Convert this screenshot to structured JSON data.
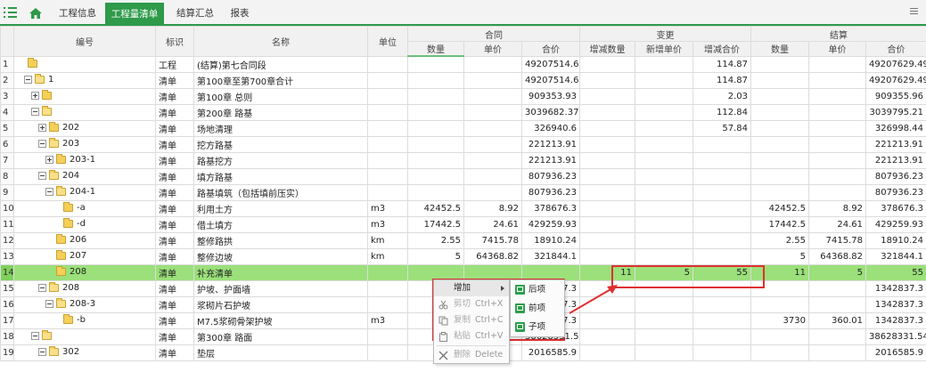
{
  "toolbar": {
    "tabs": [
      {
        "label": "工程信息"
      },
      {
        "label": "工程量清单"
      },
      {
        "label": "结算汇总"
      },
      {
        "label": "报表"
      }
    ]
  },
  "columns": {
    "code": "编号",
    "mark": "标识",
    "name": "名称",
    "unit": "单位",
    "contract": "合同",
    "change": "变更",
    "settle": "结算",
    "qty": "数量",
    "price": "单价",
    "total": "合价",
    "chg_qty": "增减数量",
    "new_price": "新增单价",
    "chg_total": "增减合价"
  },
  "rows": [
    {
      "n": "1",
      "code": "",
      "mark": "工程",
      "name": "(结算)第七合同段",
      "unit": "",
      "c_qty": "",
      "c_price": "",
      "c_total": "49207514.62",
      "v_qty": "",
      "v_price": "",
      "v_total": "114.87",
      "s_qty": "",
      "s_price": "",
      "s_total": "49207629.49"
    },
    {
      "n": "2",
      "code": "1",
      "mark": "清单",
      "name": "第100章至第700章合计",
      "unit": "",
      "c_qty": "",
      "c_price": "",
      "c_total": "49207514.62",
      "v_qty": "",
      "v_price": "",
      "v_total": "114.87",
      "s_qty": "",
      "s_price": "",
      "s_total": "49207629.49"
    },
    {
      "n": "3",
      "code": "",
      "mark": "清单",
      "name": "第100章 总则",
      "unit": "",
      "c_qty": "",
      "c_price": "",
      "c_total": "909353.93",
      "v_qty": "",
      "v_price": "",
      "v_total": "2.03",
      "s_qty": "",
      "s_price": "",
      "s_total": "909355.96"
    },
    {
      "n": "4",
      "code": "",
      "mark": "清单",
      "name": "第200章 路基",
      "unit": "",
      "c_qty": "",
      "c_price": "",
      "c_total": "3039682.37",
      "v_qty": "",
      "v_price": "",
      "v_total": "112.84",
      "s_qty": "",
      "s_price": "",
      "s_total": "3039795.21"
    },
    {
      "n": "5",
      "code": "202",
      "mark": "清单",
      "name": "场地清理",
      "unit": "",
      "c_qty": "",
      "c_price": "",
      "c_total": "326940.6",
      "v_qty": "",
      "v_price": "",
      "v_total": "57.84",
      "s_qty": "",
      "s_price": "",
      "s_total": "326998.44"
    },
    {
      "n": "6",
      "code": "203",
      "mark": "清单",
      "name": "挖方路基",
      "unit": "",
      "c_qty": "",
      "c_price": "",
      "c_total": "221213.91",
      "v_qty": "",
      "v_price": "",
      "v_total": "",
      "s_qty": "",
      "s_price": "",
      "s_total": "221213.91"
    },
    {
      "n": "7",
      "code": "203-1",
      "mark": "清单",
      "name": "路基挖方",
      "unit": "",
      "c_qty": "",
      "c_price": "",
      "c_total": "221213.91",
      "v_qty": "",
      "v_price": "",
      "v_total": "",
      "s_qty": "",
      "s_price": "",
      "s_total": "221213.91"
    },
    {
      "n": "8",
      "code": "204",
      "mark": "清单",
      "name": "填方路基",
      "unit": "",
      "c_qty": "",
      "c_price": "",
      "c_total": "807936.23",
      "v_qty": "",
      "v_price": "",
      "v_total": "",
      "s_qty": "",
      "s_price": "",
      "s_total": "807936.23"
    },
    {
      "n": "9",
      "code": "204-1",
      "mark": "清单",
      "name": "路基填筑（包括填前压实）",
      "unit": "",
      "c_qty": "",
      "c_price": "",
      "c_total": "807936.23",
      "v_qty": "",
      "v_price": "",
      "v_total": "",
      "s_qty": "",
      "s_price": "",
      "s_total": "807936.23"
    },
    {
      "n": "10",
      "code": "-a",
      "mark": "清单",
      "name": "利用土方",
      "unit": "m3",
      "c_qty": "42452.5",
      "c_price": "8.92",
      "c_total": "378676.3",
      "v_qty": "",
      "v_price": "",
      "v_total": "",
      "s_qty": "42452.5",
      "s_price": "8.92",
      "s_total": "378676.3"
    },
    {
      "n": "11",
      "code": "-d",
      "mark": "清单",
      "name": "借土填方",
      "unit": "m3",
      "c_qty": "17442.5",
      "c_price": "24.61",
      "c_total": "429259.93",
      "v_qty": "",
      "v_price": "",
      "v_total": "",
      "s_qty": "17442.5",
      "s_price": "24.61",
      "s_total": "429259.93"
    },
    {
      "n": "12",
      "code": "206",
      "mark": "清单",
      "name": "整修路拱",
      "unit": "km",
      "c_qty": "2.55",
      "c_price": "7415.78",
      "c_total": "18910.24",
      "v_qty": "",
      "v_price": "",
      "v_total": "",
      "s_qty": "2.55",
      "s_price": "7415.78",
      "s_total": "18910.24"
    },
    {
      "n": "13",
      "code": "207",
      "mark": "清单",
      "name": "整修边坡",
      "unit": "km",
      "c_qty": "5",
      "c_price": "64368.82",
      "c_total": "321844.1",
      "v_qty": "",
      "v_price": "",
      "v_total": "",
      "s_qty": "5",
      "s_price": "64368.82",
      "s_total": "321844.1"
    },
    {
      "n": "14",
      "code": "208",
      "mark": "清单",
      "name": "补充清单",
      "unit": "",
      "c_qty": "",
      "c_price": "",
      "c_total": "",
      "v_qty": "11",
      "v_price": "5",
      "v_total": "55",
      "s_qty": "11",
      "s_price": "5",
      "s_total": "55"
    },
    {
      "n": "15",
      "code": "208",
      "mark": "清单",
      "name": "护坡、护面墙",
      "unit": "",
      "c_qty": "",
      "c_price": "",
      "c_total": "1342837.3",
      "v_qty": "",
      "v_price": "",
      "v_total": "",
      "s_qty": "",
      "s_price": "",
      "s_total": "1342837.3"
    },
    {
      "n": "16",
      "code": "208-3",
      "mark": "清单",
      "name": "浆砌片石护坡",
      "unit": "",
      "c_qty": "",
      "c_price": "",
      "c_total": "1342837.3",
      "v_qty": "",
      "v_price": "",
      "v_total": "",
      "s_qty": "",
      "s_price": "",
      "s_total": "1342837.3"
    },
    {
      "n": "17",
      "code": "-b",
      "mark": "清单",
      "name": "M7.5浆砌骨架护坡",
      "unit": "m3",
      "c_qty": "",
      "c_price": "",
      "c_total": "1342837.3",
      "v_qty": "",
      "v_price": "",
      "v_total": "",
      "s_qty": "3730",
      "s_price": "360.01",
      "s_total": "1342837.3"
    },
    {
      "n": "18",
      "code": "",
      "mark": "清单",
      "name": "第300章 路面",
      "unit": "",
      "c_qty": "",
      "c_price": "",
      "c_total": "38628331.54",
      "v_qty": "",
      "v_price": "",
      "v_total": "",
      "s_qty": "",
      "s_price": "",
      "s_total": "38628331.54"
    },
    {
      "n": "19",
      "code": "302",
      "mark": "清单",
      "name": "垫层",
      "unit": "",
      "c_qty": "",
      "c_price": "",
      "c_total": "2016585.9",
      "v_qty": "",
      "v_price": "",
      "v_total": "",
      "s_qty": "",
      "s_price": "",
      "s_total": "2016585.9"
    }
  ],
  "context_menu": {
    "add": "增加",
    "cut": "剪切",
    "cut_shortcut": "Ctrl+X",
    "copy": "复制",
    "copy_shortcut": "Ctrl+C",
    "paste": "粘贴",
    "paste_shortcut": "Ctrl+V",
    "delete": "删除",
    "delete_shortcut": "Delete"
  },
  "submenu": {
    "after": "后项",
    "before": "前项",
    "child": "子项"
  },
  "colors": {
    "accent": "#2e9a4a",
    "highlight_row": "#9be07a",
    "annotation_red": "#e03030"
  }
}
